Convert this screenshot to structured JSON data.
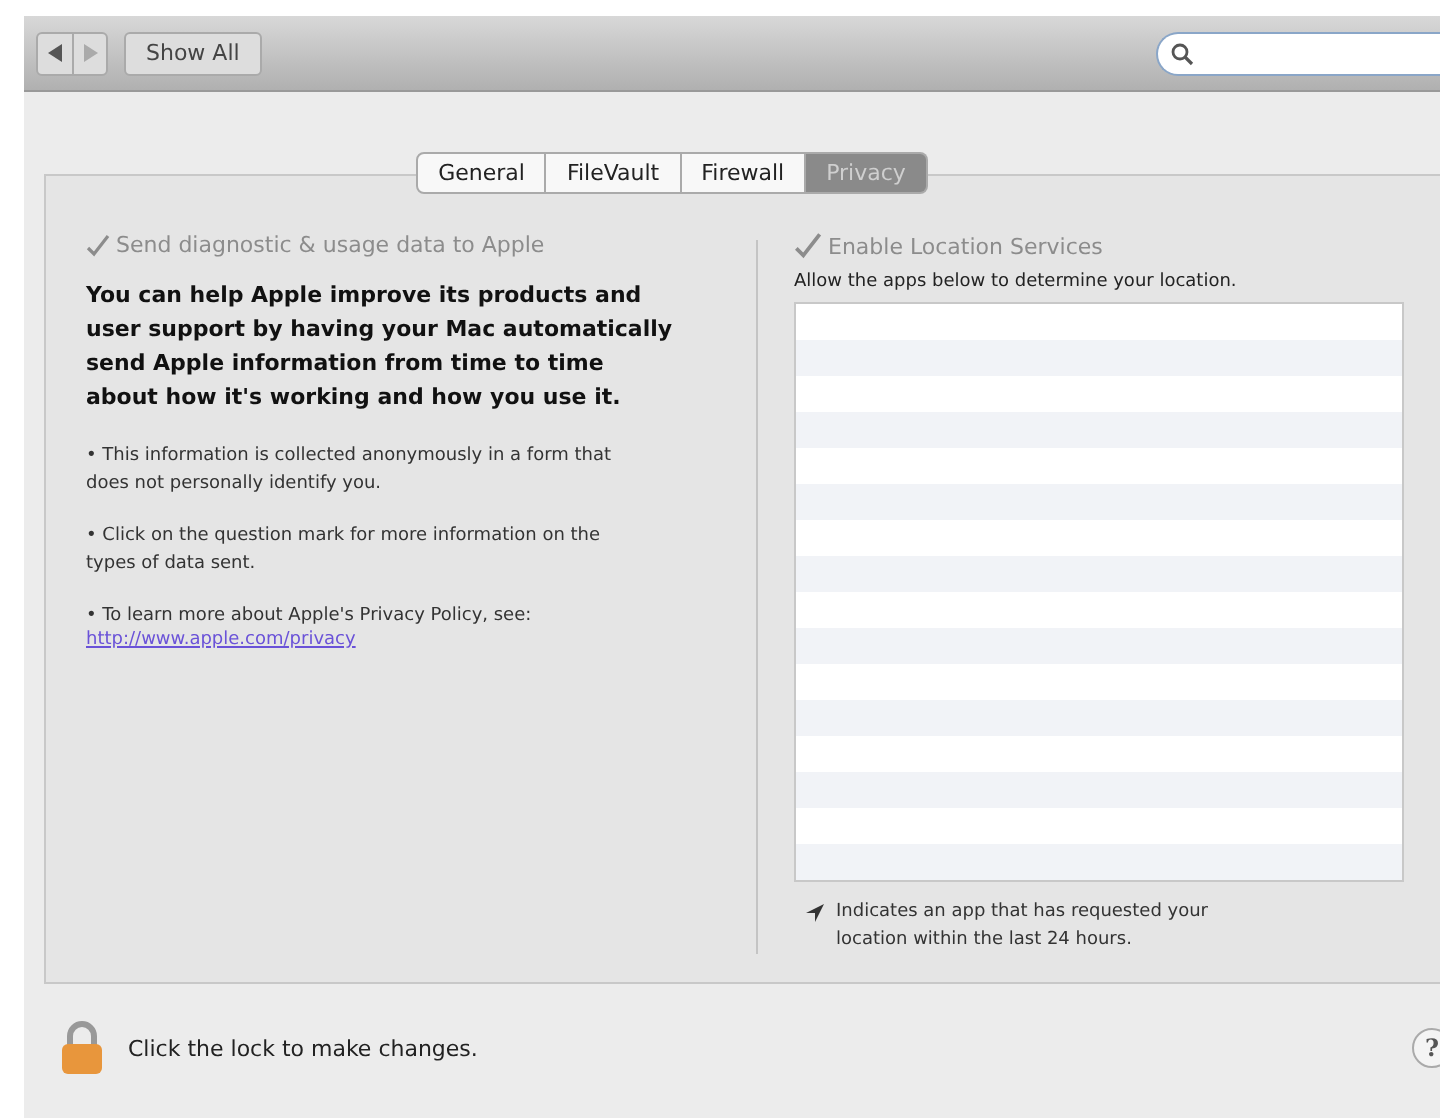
{
  "toolbar": {
    "show_all": "Show All"
  },
  "tabs": [
    {
      "label": "General",
      "selected": false
    },
    {
      "label": "FileVault",
      "selected": false
    },
    {
      "label": "Firewall",
      "selected": false
    },
    {
      "label": "Privacy",
      "selected": true
    }
  ],
  "diagnostics": {
    "checkbox": {
      "label": "Send diagnostic & usage data to Apple",
      "checked": true,
      "disabled": true
    },
    "intro": "You can help Apple improve its products and user support by having your Mac automatically send Apple information from time to time about how it's working and how you use it.",
    "notes": [
      "• This information is collected anonymously in a form that does not personally identify you.",
      "• Click on the question mark for more information on the types of data sent.",
      "• To learn more about Apple's Privacy Policy, see:"
    ],
    "link": "http://www.apple.com/privacy"
  },
  "location": {
    "checkbox": {
      "label": "Enable Location Services",
      "checked": true,
      "disabled": true
    },
    "caption": "Allow the apps below to determine your location.",
    "legend": "Indicates an app that has requested your location within the last 24 hours."
  },
  "footer": {
    "lock_text": "Click the lock to make changes.",
    "help": "?"
  }
}
